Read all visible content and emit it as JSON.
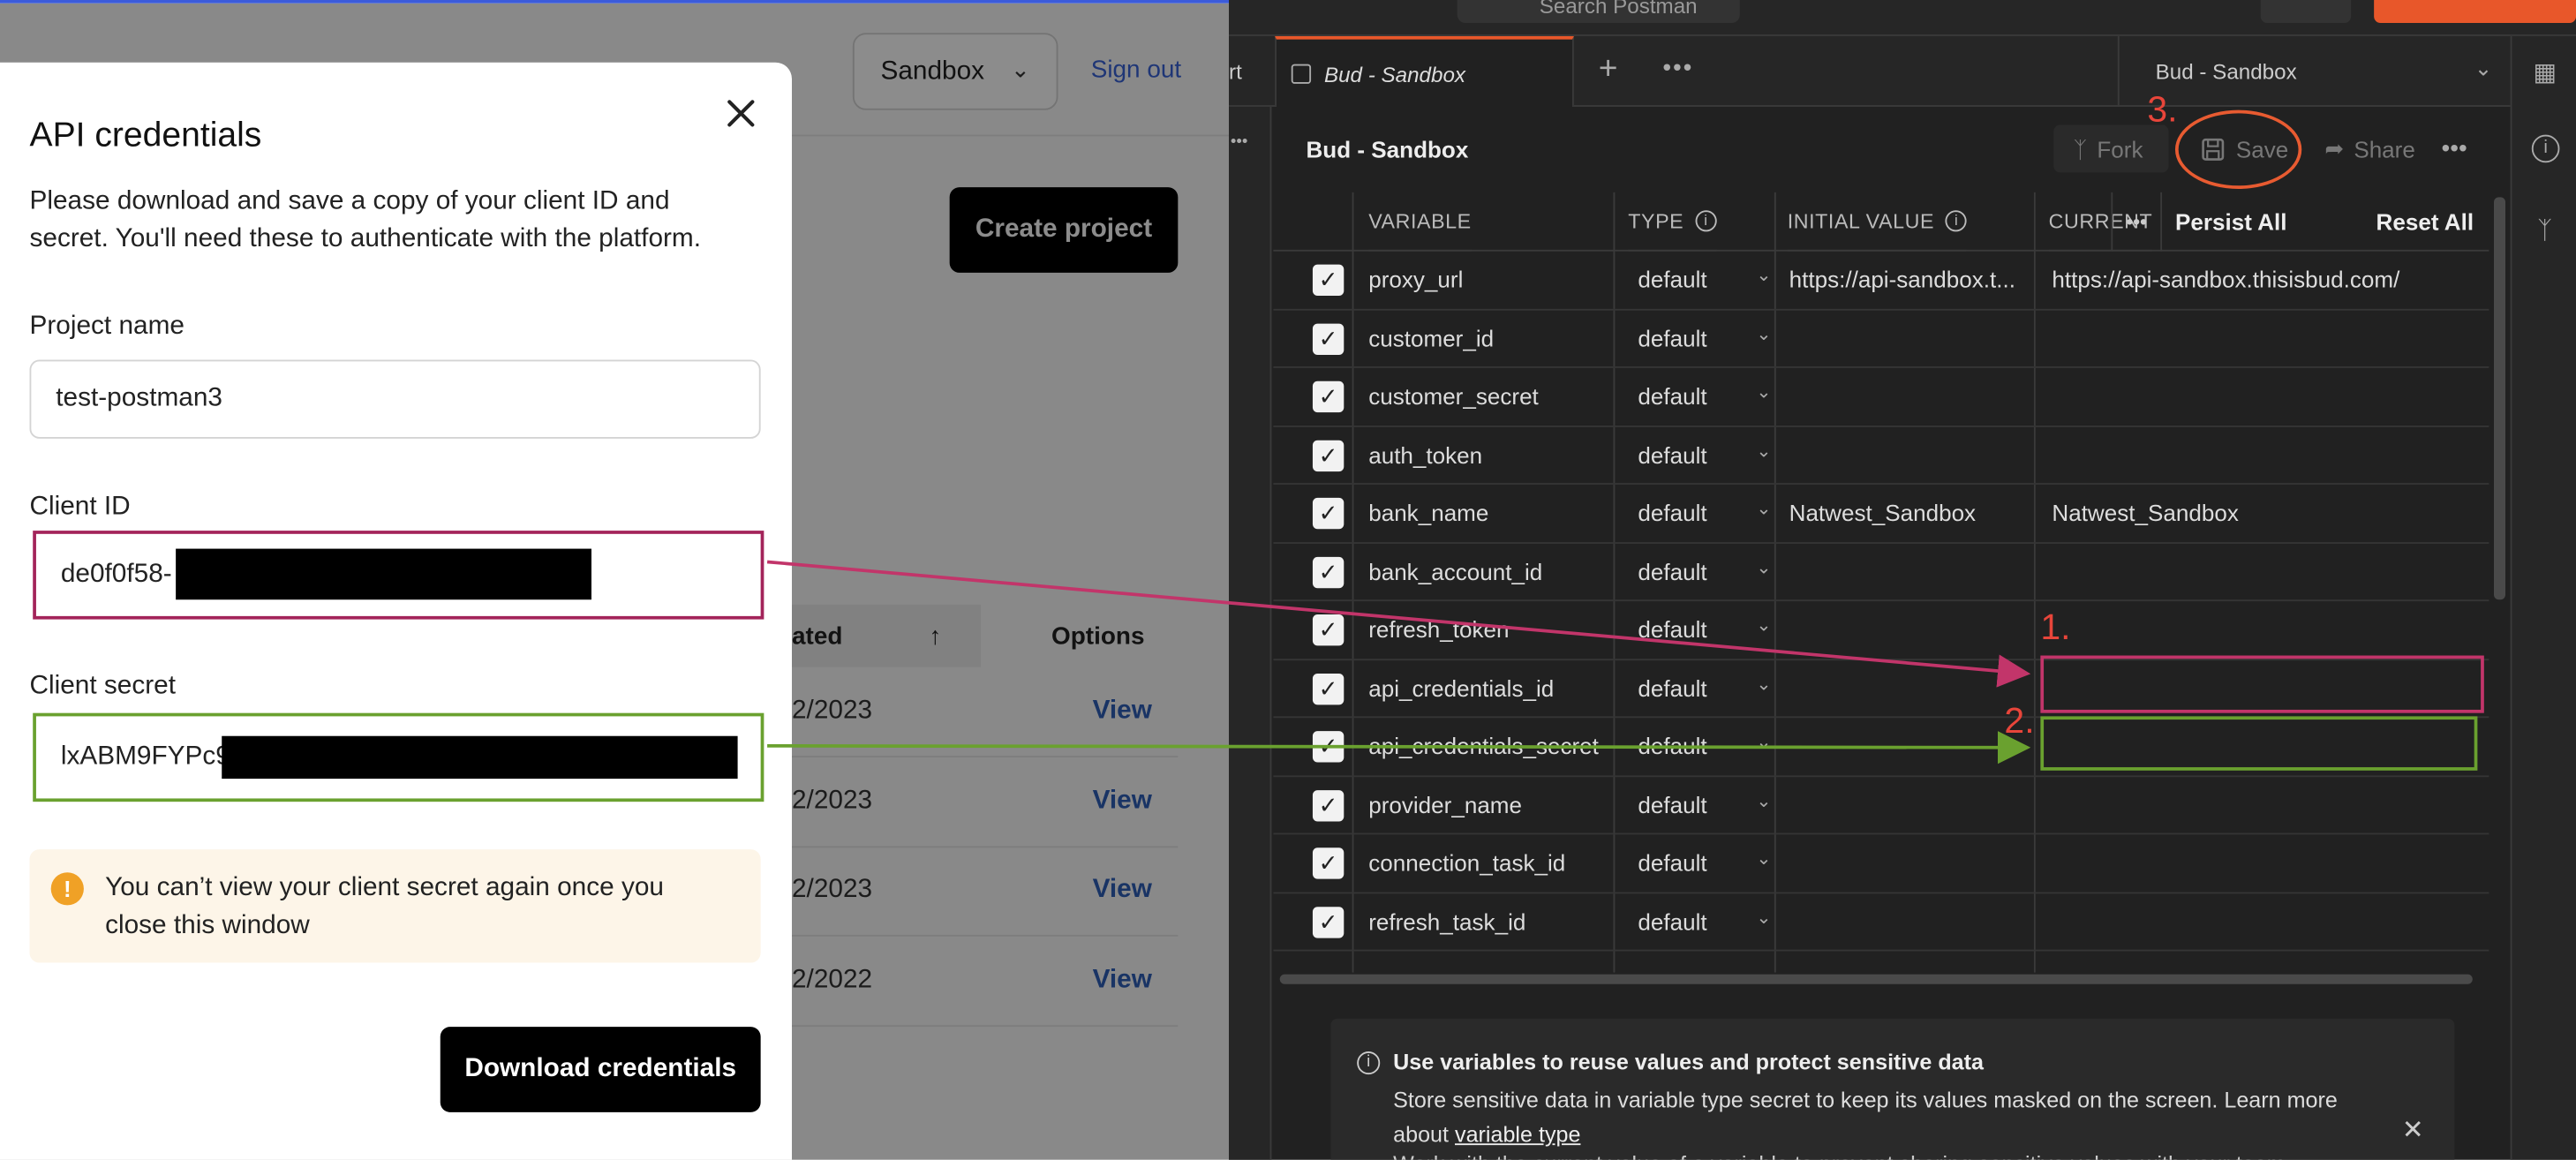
{
  "bud": {
    "env_selector": "Sandbox",
    "sign_out": "Sign out",
    "create_project": "Create project",
    "table": {
      "sorted_header": "ated",
      "sort_arrow": "↑",
      "options_header": "Options",
      "rows": [
        {
          "date": "2/2023",
          "action": "View"
        },
        {
          "date": "2/2023",
          "action": "View"
        },
        {
          "date": "2/2023",
          "action": "View"
        },
        {
          "date": "2/2022",
          "action": "View"
        }
      ]
    }
  },
  "modal": {
    "title": "API credentials",
    "description": "Please download and save a copy of your client ID and secret. You'll need these to authenticate with the platform.",
    "project_label": "Project name",
    "project_value": "test-postman3",
    "client_id_label": "Client ID",
    "client_id_value": "de0f0f58-",
    "client_secret_label": "Client secret",
    "client_secret_value": "lxABM9FYPc9",
    "warning_icon": "!",
    "warning": "You can’t view your client secret again once you close this window",
    "download_button": "Download credentials"
  },
  "postman": {
    "search_placeholder": "Search Postman",
    "tab_prev": "rt",
    "tab_active": "Bud - Sandbox",
    "env_dropdown": "Bud - Sandbox",
    "env_title": "Bud - Sandbox",
    "toolbar": {
      "fork": "Fork",
      "save": "Save",
      "share": "Share"
    },
    "columns": {
      "variable": "VARIABLE",
      "type": "TYPE",
      "initial": "INITIAL VALUE",
      "current": "CURRENT",
      "persist": "Persist All",
      "reset": "Reset All"
    },
    "variables": [
      {
        "name": "proxy_url",
        "type": "default",
        "initial": "https://api-sandbox.t...",
        "current": "https://api-sandbox.thisisbud.com/"
      },
      {
        "name": "customer_id",
        "type": "default",
        "initial": "",
        "current": ""
      },
      {
        "name": "customer_secret",
        "type": "default",
        "initial": "",
        "current": ""
      },
      {
        "name": "auth_token",
        "type": "default",
        "initial": "",
        "current": ""
      },
      {
        "name": "bank_name",
        "type": "default",
        "initial": "Natwest_Sandbox",
        "current": "Natwest_Sandbox"
      },
      {
        "name": "bank_account_id",
        "type": "default",
        "initial": "",
        "current": ""
      },
      {
        "name": "refresh_token",
        "type": "default",
        "initial": "",
        "current": ""
      },
      {
        "name": "api_credentials_id",
        "type": "default",
        "initial": "",
        "current": ""
      },
      {
        "name": "api_credentials_secret",
        "type": "default",
        "initial": "",
        "current": ""
      },
      {
        "name": "provider_name",
        "type": "default",
        "initial": "",
        "current": ""
      },
      {
        "name": "connection_task_id",
        "type": "default",
        "initial": "",
        "current": ""
      },
      {
        "name": "refresh_task_id",
        "type": "default",
        "initial": "",
        "current": ""
      }
    ],
    "info": {
      "heading": "Use variables to reuse values and protect sensitive data",
      "body_prefix": "Store sensitive data in variable type secret to keep its values masked on the screen. Learn more about ",
      "link": "variable type",
      "body2": "Work with the current value of a variable to prevent sharing sensitive values with your team."
    }
  },
  "annotations": {
    "step1": "1.",
    "step2": "2.",
    "step3": "3."
  },
  "colors": {
    "postman_accent": "#e8572a",
    "client_id_highlight": "#a3245a",
    "client_secret_highlight": "#6aa12f",
    "annotation": "#e8453a"
  }
}
